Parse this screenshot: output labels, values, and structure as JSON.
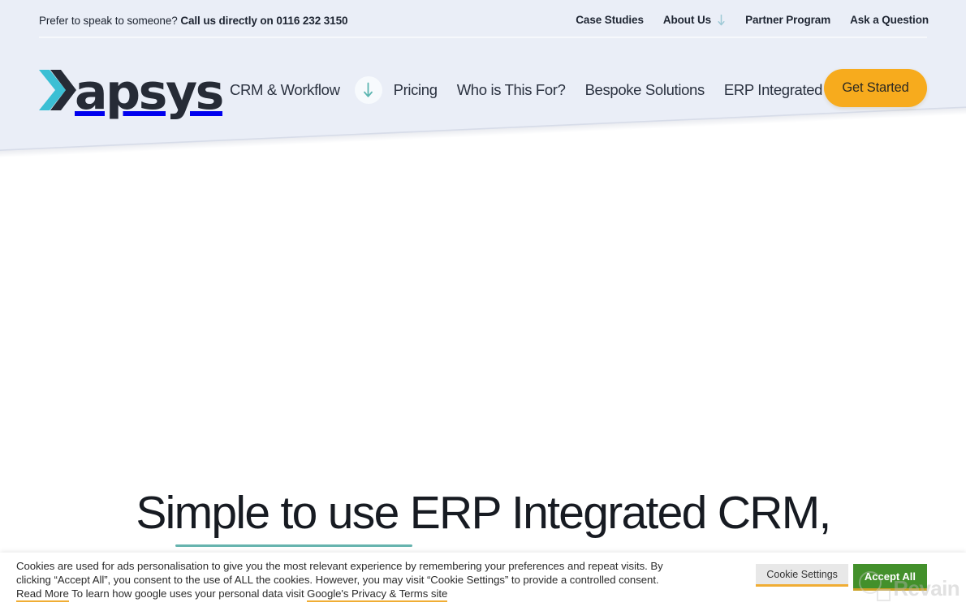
{
  "colors": {
    "header_bg": "#eaeef7",
    "page_bg": "#ffffff",
    "accent_teal": "#66b3ae",
    "logo_teal": "#3bbfd4",
    "logo_dark": "#262b36",
    "cta_amber": "#f7ab1d",
    "cookie_link_underline": "#f0ad34",
    "accept_green": "#43902b",
    "settings_gray": "#e8e8e8",
    "text_dark": "#1e2532"
  },
  "utility_bar": {
    "contact_prefix": "Prefer to speak to someone?",
    "contact_strong": "Call us directly on 0116 232 3150",
    "links": [
      {
        "label": "Case Studies",
        "icon": null
      },
      {
        "label": "About Us",
        "icon": "arrow-down-icon"
      },
      {
        "label": "Partner Program",
        "icon": null
      },
      {
        "label": "Ask a Question",
        "icon": null
      }
    ]
  },
  "brand": {
    "logo_text": "apsys",
    "logo_full": "Xapsys",
    "logo_x_icon": "logo-x-icon"
  },
  "main_nav": {
    "links": [
      {
        "label": "CRM & Workflow",
        "icon": "arrow-down-circle-icon"
      },
      {
        "label": "Pricing",
        "icon": null
      },
      {
        "label": "Who is This For?",
        "icon": null
      },
      {
        "label": "Bespoke Solutions",
        "icon": null
      },
      {
        "label": "ERP Integrated Solutions",
        "icon": null
      }
    ],
    "cta_label": "Get Started"
  },
  "hero": {
    "heading": "Simple to use ERP Integrated CRM,"
  },
  "cookie_banner": {
    "text_part_1": "Cookies are used for ads personalisation to give you the most relevant experience by remembering your preferences and repeat visits. By clicking “Accept All”, you consent to the use of ALL the cookies. However, you may visit “Cookie Settings” to provide a controlled consent. ",
    "read_more_label": "Read More",
    "text_part_2": " To learn how google uses your personal data visit ",
    "privacy_link_label": "Google's Privacy & Terms site",
    "settings_label": "Cookie Settings",
    "accept_label": "Accept All"
  },
  "watermark": {
    "label": "Revain",
    "icon": "magnifier-icon"
  }
}
